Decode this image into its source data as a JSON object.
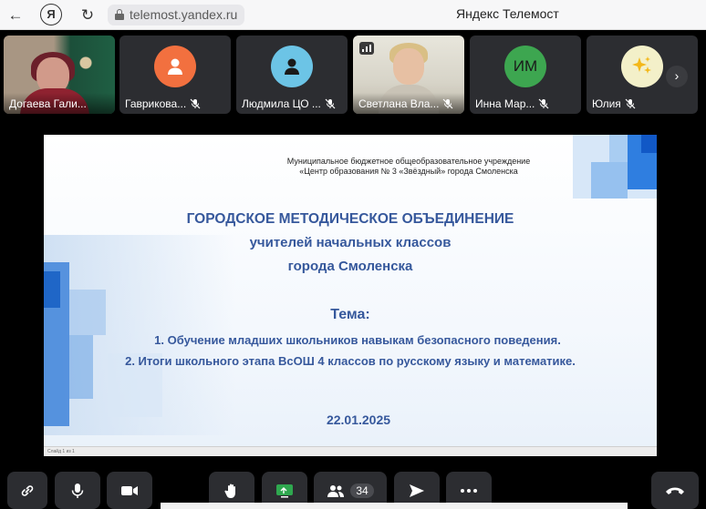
{
  "browser": {
    "url": "telemost.yandex.ru",
    "page_title": "Яндекс Телемост",
    "yandex_button": "Я"
  },
  "participants": [
    {
      "name": "Догаева Гали...",
      "type": "video",
      "muted": false
    },
    {
      "name": "Гаврикова...",
      "type": "avatar",
      "avatar_color": "#f2703f",
      "muted": true
    },
    {
      "name": "Людмила ЦО ...",
      "type": "avatar",
      "avatar_color": "#6cc4e6",
      "muted": true
    },
    {
      "name": "Светлана Вла...",
      "type": "video",
      "muted": true
    },
    {
      "name": "Инна Мар...",
      "type": "initials",
      "initials": "ИМ",
      "avatar_color": "#3da650",
      "muted": true
    },
    {
      "name": "Юлия",
      "type": "emoji",
      "avatar_color": "#f3f0c9",
      "muted": true
    }
  ],
  "slide": {
    "school_line1": "Муниципальное бюджетное общеобразовательное учреждение",
    "school_line2": "«Центр образования № 3 «Звёздный» города Смоленска",
    "heading1": "ГОРОДСКОЕ МЕТОДИЧЕСКОЕ ОБЪЕДИНЕНИЕ",
    "heading2": "учителей начальных классов",
    "heading3": "города Смоленска",
    "topic_label": "Тема:",
    "item1": "1. Обучение младших школьников навыкам безопасного поведения.",
    "item2": "2. Итоги школьного этапа ВсОШ 4 классов по русскому языку и математике.",
    "date": "22.01.2025",
    "status_text": "Слайд 1 из 1"
  },
  "toolbar": {
    "participants_count": "34"
  },
  "colors": {
    "accent_blue": "#36589c",
    "tile_bg": "#2c2d31"
  }
}
